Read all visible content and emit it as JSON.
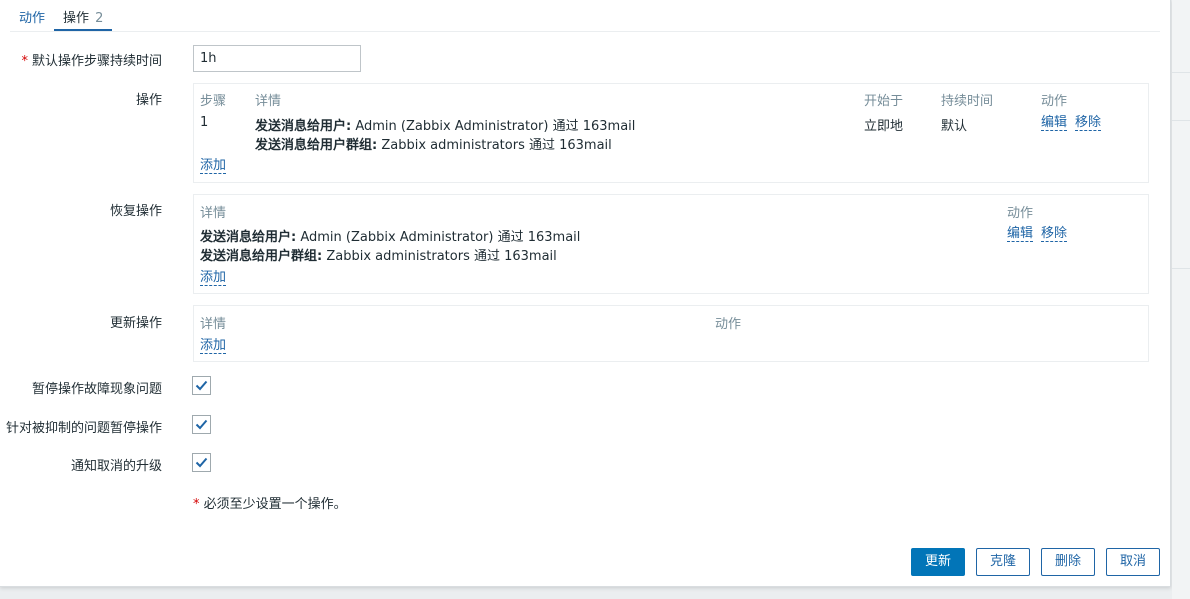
{
  "tabs": [
    {
      "label": "动作"
    },
    {
      "label": "操作",
      "count": "2"
    }
  ],
  "form": {
    "default_step_duration": {
      "label": "默认操作步骤持续时间",
      "required_marker": "*",
      "value": "1h"
    },
    "operations": {
      "label": "操作",
      "columns": [
        "步骤",
        "详情",
        "开始于",
        "持续时间",
        "动作"
      ],
      "rows": [
        {
          "step": "1",
          "details": [
            {
              "prefix": "发送消息给用户:",
              "text": " Admin (Zabbix Administrator) 通过 163mail"
            },
            {
              "prefix": "发送消息给用户群组:",
              "text": " Zabbix administrators 通过 163mail"
            }
          ],
          "start_in": "立即地",
          "duration": "默认",
          "actions": [
            "编辑",
            "移除"
          ]
        }
      ],
      "add_label": "添加"
    },
    "recovery_operations": {
      "label": "恢复操作",
      "columns": [
        "详情",
        "动作"
      ],
      "rows": [
        {
          "details": [
            {
              "prefix": "发送消息给用户:",
              "text": " Admin (Zabbix Administrator) 通过 163mail"
            },
            {
              "prefix": "发送消息给用户群组:",
              "text": " Zabbix administrators 通过 163mail"
            }
          ],
          "actions": [
            "编辑",
            "移除"
          ]
        }
      ],
      "add_label": "添加"
    },
    "update_operations": {
      "label": "更新操作",
      "columns": [
        "详情",
        "动作"
      ],
      "add_label": "添加"
    },
    "pause_symptoms": {
      "label": "暂停操作故障现象问题",
      "checked": true
    },
    "pause_suppressed": {
      "label": "针对被抑制的问题暂停操作",
      "checked": true
    },
    "notify_cancels": {
      "label": "通知取消的升级",
      "checked": true
    },
    "note": {
      "marker": "*",
      "text": " 必须至少设置一个操作。"
    }
  },
  "buttons": {
    "update": "更新",
    "clone": "克隆",
    "delete": "删除",
    "cancel": "取消"
  },
  "colors": {
    "link": "#1f65a6",
    "primary": "#0275b8",
    "required": "#d40000",
    "muted": "#768d99"
  }
}
